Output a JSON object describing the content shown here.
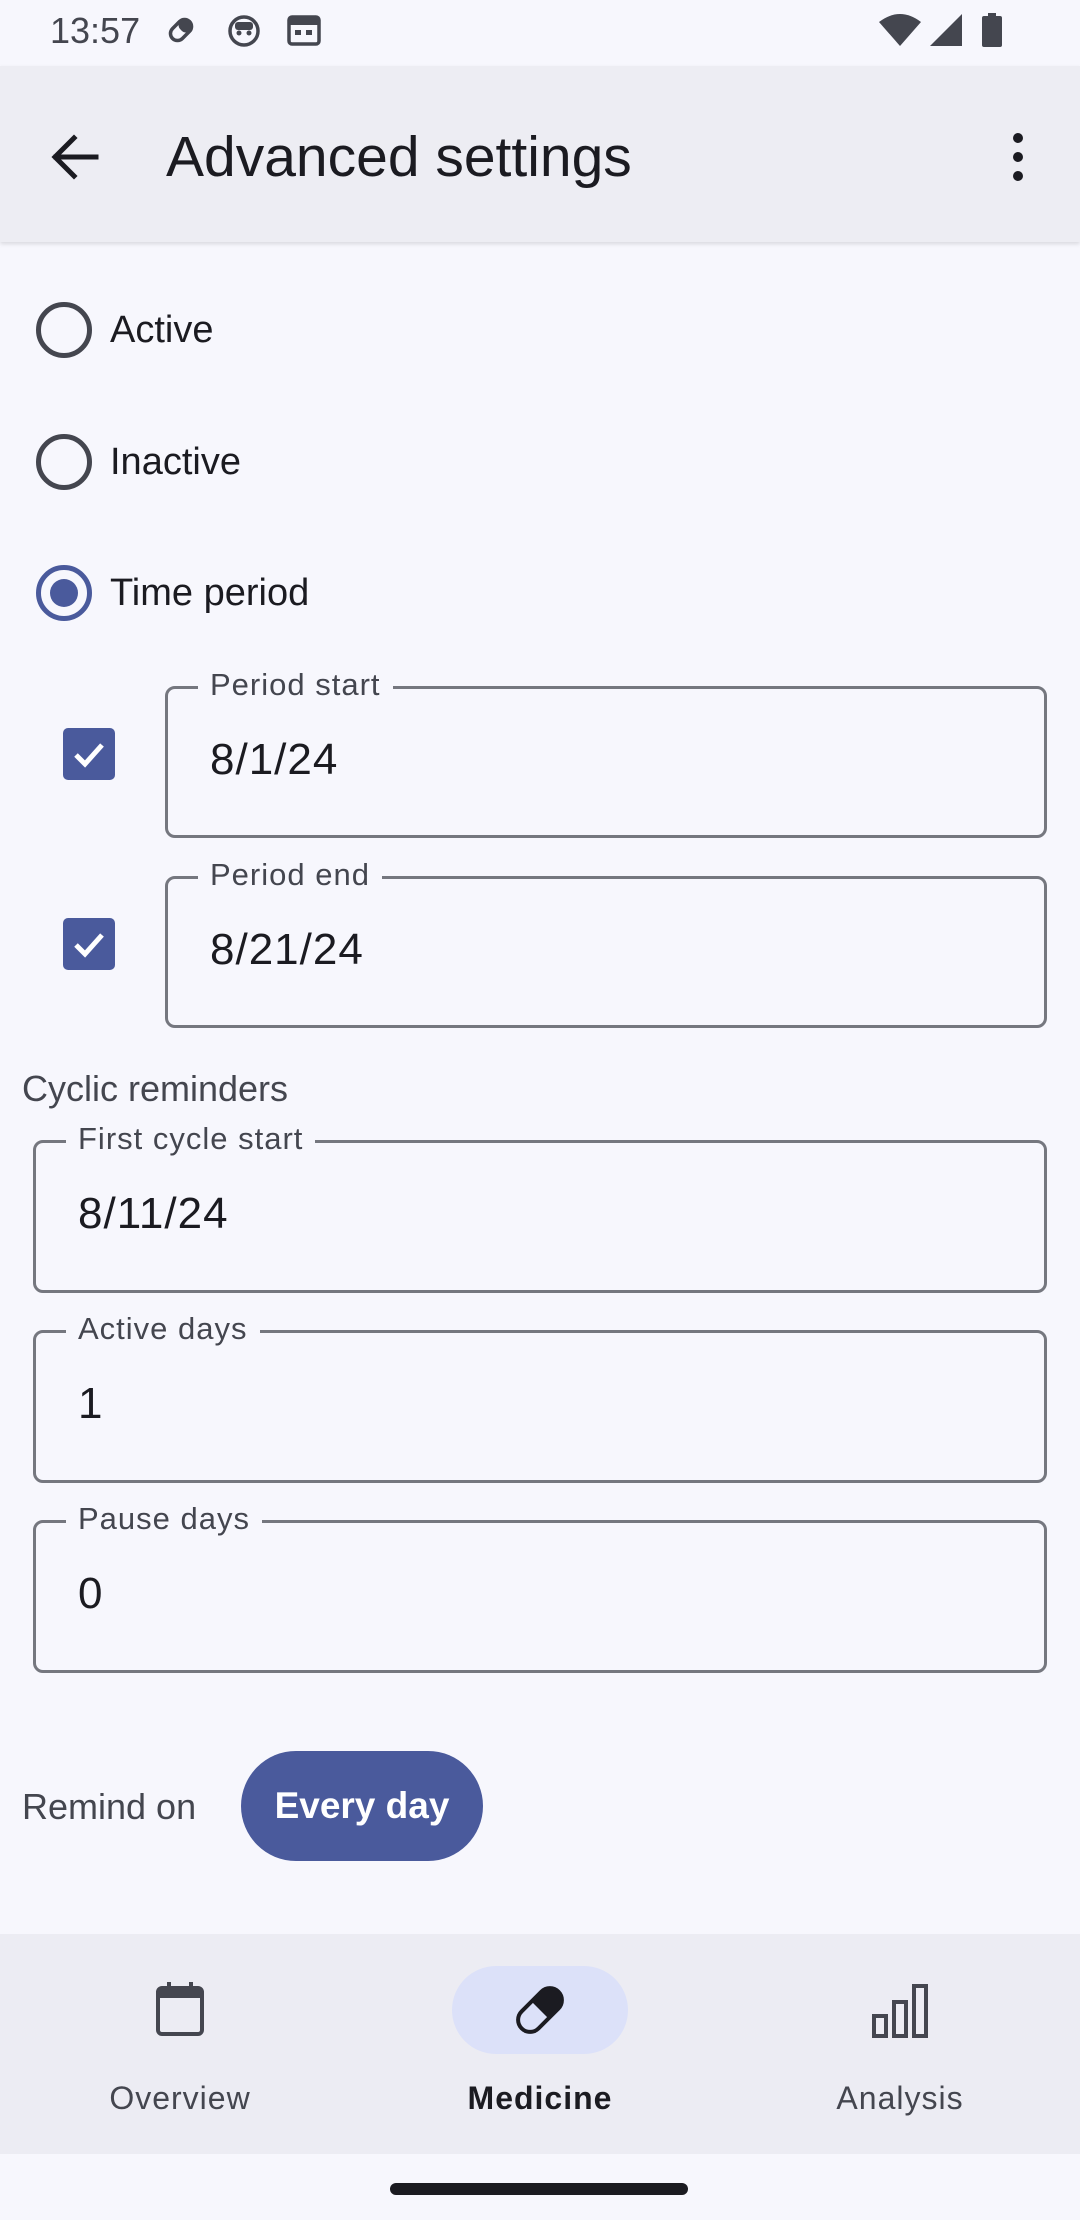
{
  "status_bar": {
    "time": "13:57",
    "left_icons": [
      "pill-icon",
      "face-icon",
      "calendar-icon"
    ],
    "right_icons": [
      "wifi-icon",
      "signal-icon",
      "battery-icon"
    ]
  },
  "app_bar": {
    "back_icon": "arrow-back-icon",
    "title": "Advanced settings",
    "menu_icon": "more-vert-icon"
  },
  "status_options": [
    {
      "label": "Active",
      "selected": false
    },
    {
      "label": "Inactive",
      "selected": false
    },
    {
      "label": "Time period",
      "selected": true
    }
  ],
  "period": {
    "start": {
      "label": "Period start",
      "value": "8/1/24",
      "enabled": true
    },
    "end": {
      "label": "Period end",
      "value": "8/21/24",
      "enabled": true
    }
  },
  "cyclic": {
    "section_label": "Cyclic reminders",
    "first_cycle_start": {
      "label": "First cycle start",
      "value": "8/11/24"
    },
    "active_days": {
      "label": "Active days",
      "value": "1"
    },
    "pause_days": {
      "label": "Pause days",
      "value": "0"
    }
  },
  "remind": {
    "label": "Remind on",
    "chip": "Every day"
  },
  "bottom_nav": {
    "items": [
      {
        "label": "Overview",
        "icon": "calendar-icon",
        "active": false
      },
      {
        "label": "Medicine",
        "icon": "pill-icon",
        "active": true
      },
      {
        "label": "Analysis",
        "icon": "bar-chart-icon",
        "active": false
      }
    ]
  },
  "colors": {
    "accent": "#4a5a9c",
    "background": "#f7f7fd",
    "app_bar": "#ededf3",
    "nav_active_indicator": "#dce1f9"
  }
}
